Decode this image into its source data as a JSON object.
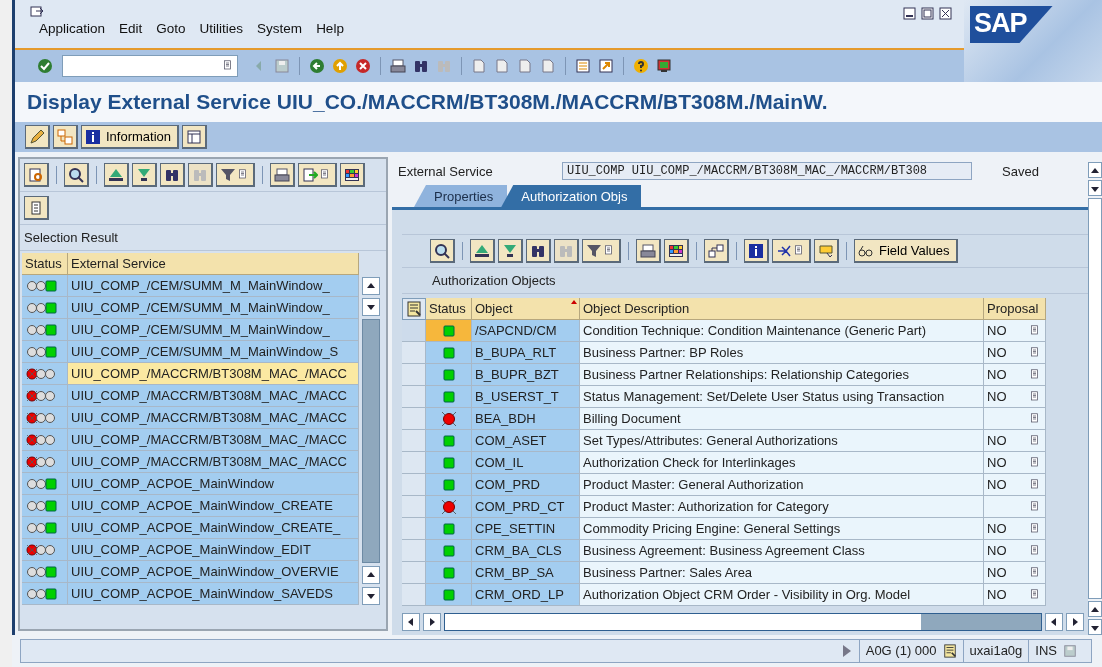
{
  "menu": [
    "Application",
    "Edit",
    "Goto",
    "Utilities",
    "System",
    "Help"
  ],
  "logo": "SAP",
  "title": "Display External Service UIU_CO./MACCRM/BT308M./MACCRM/BT308M./MainW.",
  "app_toolbar": {
    "information_button": "Information"
  },
  "selection": {
    "title": "Selection Result",
    "columns": [
      "Status",
      "External Service"
    ],
    "rows": [
      {
        "error": false,
        "service": "UIU_COMP_/CEM/SUMM_M_MainWindow_",
        "selected": false
      },
      {
        "error": false,
        "service": "UIU_COMP_/CEM/SUMM_M_MainWindow_",
        "selected": false
      },
      {
        "error": false,
        "service": "UIU_COMP_/CEM/SUMM_M_MainWindow_",
        "selected": false
      },
      {
        "error": false,
        "service": "UIU_COMP_/CEM/SUMM_M_MainWindow_S",
        "selected": false
      },
      {
        "error": true,
        "service": "UIU_COMP_/MACCRM/BT308M_MAC_/MACC",
        "selected": true
      },
      {
        "error": true,
        "service": "UIU_COMP_/MACCRM/BT308M_MAC_/MACC",
        "selected": false
      },
      {
        "error": true,
        "service": "UIU_COMP_/MACCRM/BT308M_MAC_/MACC",
        "selected": false
      },
      {
        "error": true,
        "service": "UIU_COMP_/MACCRM/BT308M_MAC_/MACC",
        "selected": false
      },
      {
        "error": true,
        "service": "UIU_COMP_/MACCRM/BT308M_MAC_/MACC",
        "selected": false
      },
      {
        "error": false,
        "service": "UIU_COMP_ACPOE_MainWindow",
        "selected": false
      },
      {
        "error": false,
        "service": "UIU_COMP_ACPOE_MainWindow_CREATE",
        "selected": false
      },
      {
        "error": false,
        "service": "UIU_COMP_ACPOE_MainWindow_CREATE_",
        "selected": false
      },
      {
        "error": true,
        "service": "UIU_COMP_ACPOE_MainWindow_EDIT",
        "selected": false
      },
      {
        "error": false,
        "service": "UIU_COMP_ACPOE_MainWindow_OVERVIE",
        "selected": false
      },
      {
        "error": false,
        "service": "UIU_COMP_ACPOE_MainWindow_SAVEDS",
        "selected": false
      }
    ]
  },
  "external_service": {
    "label": "External Service",
    "value": "UIU_COMP UIU_COMP_/MACCRM/BT308M_MAC_/MACCRM/BT308",
    "state": "Saved"
  },
  "tabs": [
    {
      "label": "Properties",
      "selected": false
    },
    {
      "label": "Authorization Objs",
      "selected": true
    }
  ],
  "authorization": {
    "field_values_button": "Field Values",
    "title": "Authorization Objects",
    "columns": [
      "Status",
      "Object",
      "Object Description",
      "Proposal"
    ],
    "rows": [
      {
        "error": false,
        "object": "/SAPCND/CM",
        "description": "Condition Technique: Condition Maintenance (Generic Part)",
        "proposal": "NO",
        "selected": true
      },
      {
        "error": false,
        "object": "B_BUPA_RLT",
        "description": "Business Partner: BP Roles",
        "proposal": "NO",
        "selected": false
      },
      {
        "error": false,
        "object": "B_BUPR_BZT",
        "description": "Business Partner Relationships: Relationship Categories",
        "proposal": "NO",
        "selected": false
      },
      {
        "error": false,
        "object": "B_USERST_T",
        "description": "Status Management: Set/Delete User Status using Transaction",
        "proposal": "NO",
        "selected": false
      },
      {
        "error": true,
        "object": "BEA_BDH",
        "description": "Billing Document",
        "selected": false
      },
      {
        "error": false,
        "object": "COM_ASET",
        "description": "Set Types/Attributes: General Authorizations",
        "proposal": "NO",
        "selected": false
      },
      {
        "error": false,
        "object": "COM_IL",
        "description": "Authorization Check for Interlinkages",
        "proposal": "NO",
        "selected": false
      },
      {
        "error": false,
        "object": "COM_PRD",
        "description": "Product Master: General Authorization",
        "proposal": "NO",
        "selected": false
      },
      {
        "error": true,
        "object": "COM_PRD_CT",
        "description": "Product Master: Authorization for Category",
        "selected": false
      },
      {
        "error": false,
        "object": "CPE_SETTIN",
        "description": "Commodity Pricing Engine: General Settings",
        "proposal": "NO",
        "selected": false
      },
      {
        "error": false,
        "object": "CRM_BA_CLS",
        "description": "Business Agreement: Business Agreement Class",
        "proposal": "NO",
        "selected": false
      },
      {
        "error": false,
        "object": "CRM_BP_SA",
        "description": "Business Partner: Sales Area",
        "proposal": "NO",
        "selected": false
      },
      {
        "error": false,
        "object": "CRM_ORD_LP",
        "description": "Authorization Object CRM Order - Visibility in Org. Model",
        "proposal": "NO",
        "selected": false
      }
    ]
  },
  "status_bar": {
    "system": "A0G (1) 000",
    "user": "uxai1a0g",
    "mode": "INS"
  }
}
